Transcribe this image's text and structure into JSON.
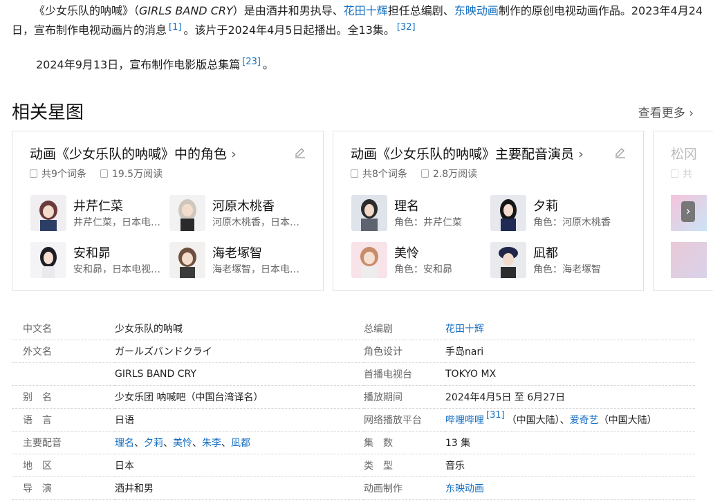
{
  "intro": {
    "p1_a": "《少女乐队的呐喊》（",
    "p1_en": "GIRLS BAND CRY",
    "p1_b": "）是由酒井和男执导、",
    "p1_link1": "花田十辉",
    "p1_c": "担任总编剧、",
    "p1_link2": "东映动画",
    "p1_d": "制作的原创电视动画作品。2023年4月24日，宣布制作电视动画片的消息",
    "ref1": "[1]",
    "p1_e": "。该片于2024年4月5日起播出。全13集。",
    "ref2": "[32]",
    "p2_a": "2024年9月13日，宣布制作电影版总集篇",
    "ref3": "[23]",
    "p2_b": "。"
  },
  "relations": {
    "title": "相关星图",
    "more": "查看更多",
    "cards": [
      {
        "title": "动画《少女乐队的呐喊》中的角色",
        "entries": "共9个词条",
        "reads": "19.5万阅读",
        "people": [
          {
            "name": "井芹仁菜",
            "desc": "井芹仁菜，日本电视动画"
          },
          {
            "name": "河原木桃香",
            "desc": "河原木桃香，日本电视动画"
          },
          {
            "name": "安和昴",
            "desc": "安和昴，日本电视动画"
          },
          {
            "name": "海老塚智",
            "desc": "海老塚智，日本电视动画"
          }
        ]
      },
      {
        "title": "动画《少女乐队的呐喊》主要配音演员",
        "entries": "共8个词条",
        "reads": "2.8万阅读",
        "people": [
          {
            "name": "理名",
            "desc": "角色：井芹仁菜"
          },
          {
            "name": "夕莉",
            "desc": "角色：河原木桃香"
          },
          {
            "name": "美怜",
            "desc": "角色：安和昴"
          },
          {
            "name": "凪都",
            "desc": "角色：海老塚智"
          }
        ]
      },
      {
        "title": "松冈",
        "entries": "共"
      }
    ]
  },
  "info": {
    "rows": [
      {
        "k1": "中文名",
        "v1": "少女乐队的呐喊",
        "k2": "总编剧",
        "v2": "花田十辉"
      },
      {
        "k1": "外文名",
        "v1": "ガールズバンドクライ",
        "k2": "角色设计",
        "v2": "手岛nari"
      },
      {
        "k1": "",
        "v1": "GIRLS BAND CRY",
        "k2": "首播电视台",
        "v2": "TOKYO MX"
      },
      {
        "k1": "别　名",
        "v1": "少女乐团 呐喊吧（中国台湾译名）",
        "k2": "播放期间",
        "v2": "2024年4月5日 至 6月27日"
      },
      {
        "k1": "语　言",
        "v1": "日语",
        "k2": "网络播放平台"
      },
      {
        "k1": "主要配音",
        "k2": "集　数",
        "v2": "13 集"
      },
      {
        "k1": "地　区",
        "v1": "日本",
        "k2": "类　型",
        "v2": "音乐"
      },
      {
        "k1": "导　演",
        "v1": "酒井和男",
        "k2": "动画制作",
        "v2": "东映动画"
      }
    ],
    "platform": {
      "link1": "哔哩哔哩",
      "ref": "[31]",
      "text1": "（中国大陆）、",
      "link2": "爱奇艺",
      "text2": "（中国大陆）"
    },
    "voice": {
      "names": [
        "理名",
        "夕莉",
        "美怜",
        "朱李",
        "凪都"
      ],
      "sep": "、"
    }
  }
}
